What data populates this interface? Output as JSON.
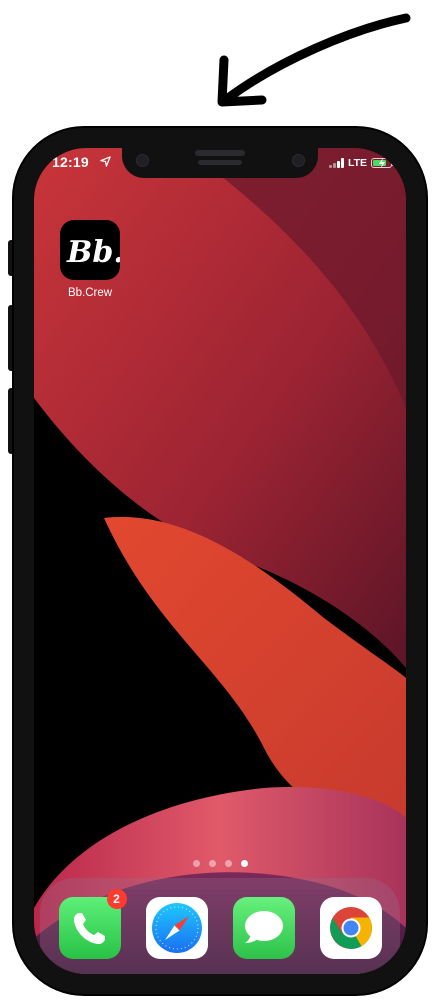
{
  "status_bar": {
    "time": "12:19",
    "carrier_network": "LTE",
    "location_icon": "location-arrow-icon",
    "signal_icon": "cellular-signal-icon",
    "battery_icon": "battery-charging-icon"
  },
  "home_screen": {
    "apps": [
      {
        "label": "Bb.Crew",
        "icon": "bb-crew-logo-icon",
        "logo_text": "Bb."
      }
    ],
    "page_indicator": {
      "pages": 4,
      "current_page": 4
    }
  },
  "dock": {
    "apps": [
      {
        "name": "Phone",
        "icon": "phone-icon",
        "badge": "2"
      },
      {
        "name": "Safari",
        "icon": "safari-compass-icon"
      },
      {
        "name": "Messages",
        "icon": "messages-icon"
      },
      {
        "name": "Chrome",
        "icon": "chrome-icon"
      }
    ]
  },
  "colors": {
    "badge": "#ff3b30",
    "phone_green": "#34c759",
    "messages_green": "#4cd964",
    "battery_green": "#4cd964",
    "wallpaper_red": "#c8322c",
    "wallpaper_orange": "#e4502f",
    "wallpaper_magenta": "#b0305a"
  }
}
